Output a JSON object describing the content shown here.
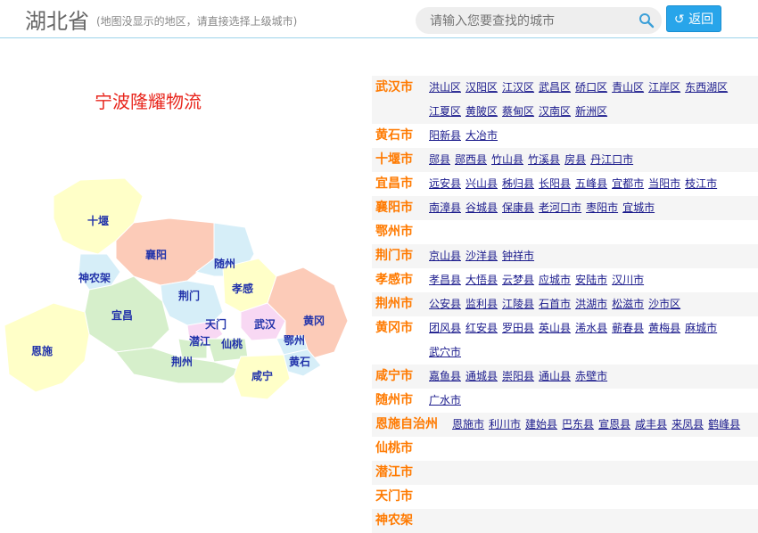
{
  "header": {
    "province": "湖北省",
    "hint": "(地图没显示的地区，请直接选择上级城市)",
    "search_placeholder": "请输入您要查找的城市",
    "back_label": "返回"
  },
  "company": "宁波隆耀物流",
  "map_labels": [
    "十堰",
    "襄阳",
    "随州",
    "神农架",
    "荆门",
    "孝感",
    "宜昌",
    "天门",
    "武汉",
    "黄冈",
    "恩施",
    "潜江",
    "仙桃",
    "鄂州",
    "荆州",
    "黄石",
    "咸宁"
  ],
  "cities": [
    {
      "name": "武汉市",
      "districts": [
        "洪山区",
        "汉阳区",
        "江汉区",
        "武昌区",
        "硚口区",
        "青山区",
        "江岸区",
        "东西湖区",
        "江夏区",
        "黄陂区",
        "蔡甸区",
        "汉南区",
        "新洲区"
      ]
    },
    {
      "name": "黄石市",
      "districts": [
        "阳新县",
        "大冶市"
      ]
    },
    {
      "name": "十堰市",
      "districts": [
        "郧县",
        "郧西县",
        "竹山县",
        "竹溪县",
        "房县",
        "丹江口市"
      ]
    },
    {
      "name": "宜昌市",
      "districts": [
        "远安县",
        "兴山县",
        "秭归县",
        "长阳县",
        "五峰县",
        "宜都市",
        "当阳市",
        "枝江市"
      ]
    },
    {
      "name": "襄阳市",
      "districts": [
        "南漳县",
        "谷城县",
        "保康县",
        "老河口市",
        "枣阳市",
        "宜城市"
      ]
    },
    {
      "name": "鄂州市",
      "districts": []
    },
    {
      "name": "荆门市",
      "districts": [
        "京山县",
        "沙洋县",
        "钟祥市"
      ]
    },
    {
      "name": "孝感市",
      "districts": [
        "孝昌县",
        "大悟县",
        "云梦县",
        "应城市",
        "安陆市",
        "汉川市"
      ]
    },
    {
      "name": "荆州市",
      "districts": [
        "公安县",
        "监利县",
        "江陵县",
        "石首市",
        "洪湖市",
        "松滋市",
        "沙市区"
      ]
    },
    {
      "name": "黄冈市",
      "districts": [
        "团风县",
        "红安县",
        "罗田县",
        "英山县",
        "浠水县",
        "蕲春县",
        "黄梅县",
        "麻城市",
        "武穴市"
      ]
    },
    {
      "name": "咸宁市",
      "districts": [
        "嘉鱼县",
        "通城县",
        "崇阳县",
        "通山县",
        "赤壁市"
      ]
    },
    {
      "name": "随州市",
      "districts": [
        "广水市"
      ]
    },
    {
      "name": "恩施自治州",
      "districts": [
        "恩施市",
        "利川市",
        "建始县",
        "巴东县",
        "宣恩县",
        "咸丰县",
        "来凤县",
        "鹤峰县"
      ]
    },
    {
      "name": "仙桃市",
      "districts": []
    },
    {
      "name": "潜江市",
      "districts": []
    },
    {
      "name": "天门市",
      "districts": []
    },
    {
      "name": "神农架",
      "districts": []
    }
  ],
  "colors": {
    "accent": "#ff7a00",
    "link": "#1a1a8c",
    "button": "#28a5ea",
    "company": "#e8261d"
  }
}
